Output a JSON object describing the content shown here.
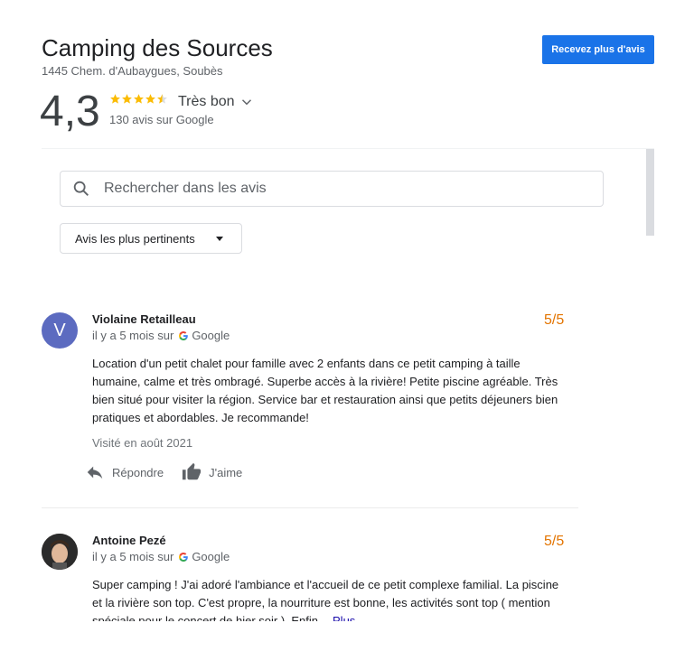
{
  "header": {
    "title": "Camping des Sources",
    "address": "1445 Chem. d'Aubaygues, Soubès",
    "cta_label": "Recevez plus d'avis"
  },
  "rating": {
    "value": "4,3",
    "stars": 4.5,
    "label": "Très bon",
    "count_text": "130 avis sur Google",
    "star_color": "#fbbc04"
  },
  "search": {
    "placeholder": "Rechercher dans les avis",
    "value": ""
  },
  "sort": {
    "selected": "Avis les plus pertinents"
  },
  "reviews": [
    {
      "initial": "V",
      "avatar_color": "#5c6bc0",
      "author": "Violaine Retailleau",
      "time": "il y a 5 mois sur",
      "source": "Google",
      "score": "5/5",
      "text": "Location d'un petit chalet pour famille avec 2 enfants dans ce petit camping à taille humaine, calme et très ombragé. Superbe accès à la rivière! Petite piscine agréable. Très bien situé pour visiter la région. Service bar et restauration ainsi que petits déjeuners bien pratiques et abordables. Je recommande!",
      "visited": "Visité en août 2021",
      "reply_label": "Répondre",
      "like_label": "J'aime"
    },
    {
      "author": "Antoine Pezé",
      "time": "il y a 5 mois sur",
      "source": "Google",
      "score": "5/5",
      "text": "Super camping ! J'ai adoré l'ambiance et l'accueil de ce petit complexe familial. La piscine et la rivière son top. C'est propre, la nourriture est bonne, les activités sont top ( mention spéciale pour le concert de hier soir ). Enfin",
      "more_label": "Plus"
    }
  ]
}
